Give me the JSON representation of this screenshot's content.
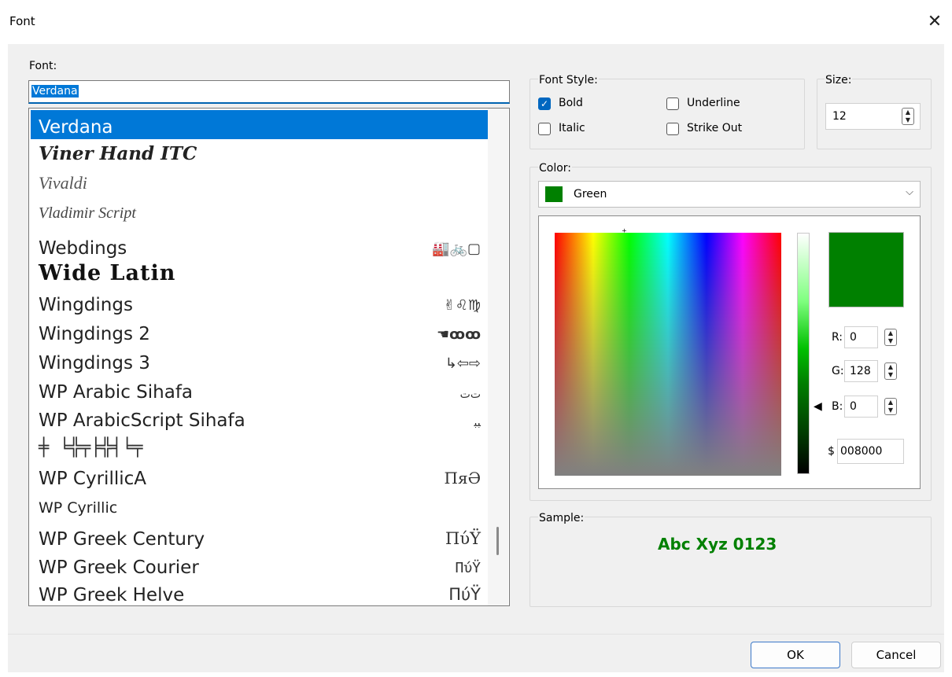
{
  "window": {
    "title": "Font",
    "close_icon": "close-icon",
    "close_glyph": "✕"
  },
  "font_label": "Font:",
  "font_input_value": "Verdana",
  "font_list": [
    {
      "name": "Verdana",
      "sample": "",
      "selected": true
    },
    {
      "name": "Viner Hand ITC",
      "sample": ""
    },
    {
      "name": "Vivaldi",
      "sample": ""
    },
    {
      "name": "Vladimir Script",
      "sample": ""
    },
    {
      "name": "Webdings",
      "sample": "🏭🚲▢"
    },
    {
      "name": "Wide Latin",
      "sample": ""
    },
    {
      "name": "Wingdings",
      "sample": "✌♌♍"
    },
    {
      "name": "Wingdings 2",
      "sample": "☚ꝏꝏ"
    },
    {
      "name": "Wingdings 3",
      "sample": "↳⇦⇨"
    },
    {
      "name": "WP Arabic Sihafa",
      "sample": "ﺕﺕ"
    },
    {
      "name": "WP ArabicScript Sihafa",
      "sample": "ﺒﺒ"
    },
    {
      "name": "╪ ╘╬╤╞╬╡╘╤",
      "sample": ""
    },
    {
      "name": "WP CyrillicA",
      "sample": "ПяӘ"
    },
    {
      "name": "WP Cyrillic",
      "sample": ""
    },
    {
      "name": "WP Greek Century",
      "sample": "ΠύΫ"
    },
    {
      "name": "WP Greek Courier",
      "sample": "ΠύΫ"
    },
    {
      "name": "WP Greek Helve",
      "sample": "ΠύΫ"
    }
  ],
  "font_style": {
    "label": "Font Style:",
    "bold": {
      "label": "Bold",
      "checked": true
    },
    "italic": {
      "label": "Italic",
      "checked": false
    },
    "underline": {
      "label": "Underline",
      "checked": false
    },
    "strikeout": {
      "label": "Strike Out",
      "checked": false
    }
  },
  "size": {
    "label": "Size:",
    "value": "12"
  },
  "color": {
    "label": "Color:",
    "selected_name": "Green",
    "selected_hex": "#008000",
    "r_label": "R:",
    "r_value": "0",
    "g_label": "G:",
    "g_value": "128",
    "b_label": "B:",
    "b_value": "0",
    "hex_label": "$",
    "hex_value": "008000"
  },
  "sample": {
    "label": "Sample:",
    "text": "Abc Xyz 0123"
  },
  "buttons": {
    "ok": "OK",
    "cancel": "Cancel"
  }
}
